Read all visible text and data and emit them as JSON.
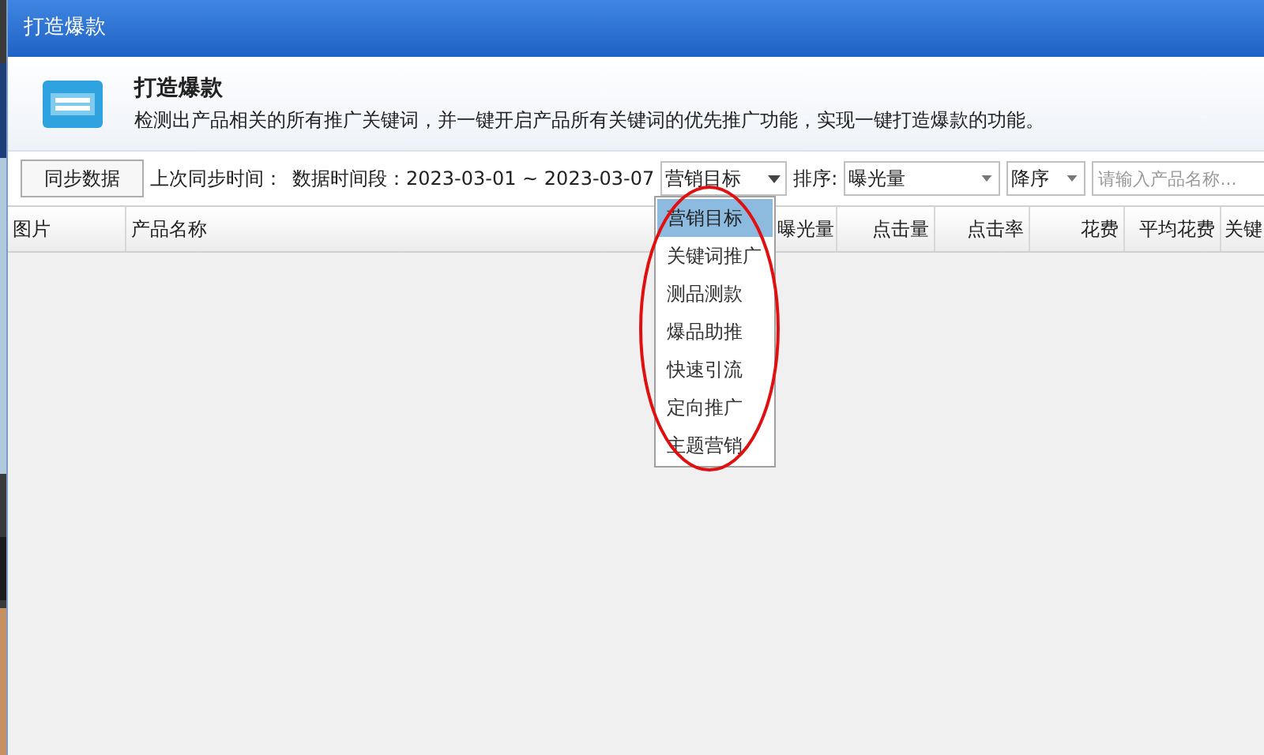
{
  "window": {
    "title": "打造爆款"
  },
  "header": {
    "title": "打造爆款",
    "description": "检测出产品相关的所有推广关键词，并一键开启产品所有关键词的优先推广功能，实现一键打造爆款的功能。"
  },
  "toolbar": {
    "sync_button": "同步数据",
    "last_sync_label": "上次同步时间：",
    "date_range": "数据时间段：2023-03-01 ~ 2023-03-07",
    "goal_select": "营销目标",
    "sort_label": "排序:",
    "sort_select": "曝光量",
    "order_select": "降序",
    "search": {
      "placeholder": "请输入产品名称..."
    }
  },
  "table": {
    "columns": [
      {
        "label": "图片"
      },
      {
        "label": "产品名称"
      },
      {
        "label": "曝光量"
      },
      {
        "label": "点击量"
      },
      {
        "label": "点击率"
      },
      {
        "label": "花费"
      },
      {
        "label": "平均花费"
      },
      {
        "label": "关键"
      }
    ]
  },
  "dropdown": {
    "items": [
      {
        "label": "营销目标",
        "selected": true
      },
      {
        "label": "关键词推广",
        "selected": false
      },
      {
        "label": "测品测款",
        "selected": false
      },
      {
        "label": "爆品助推",
        "selected": false
      },
      {
        "label": "快速引流",
        "selected": false
      },
      {
        "label": "定向推广",
        "selected": false
      },
      {
        "label": "主题营销",
        "selected": false
      }
    ]
  }
}
